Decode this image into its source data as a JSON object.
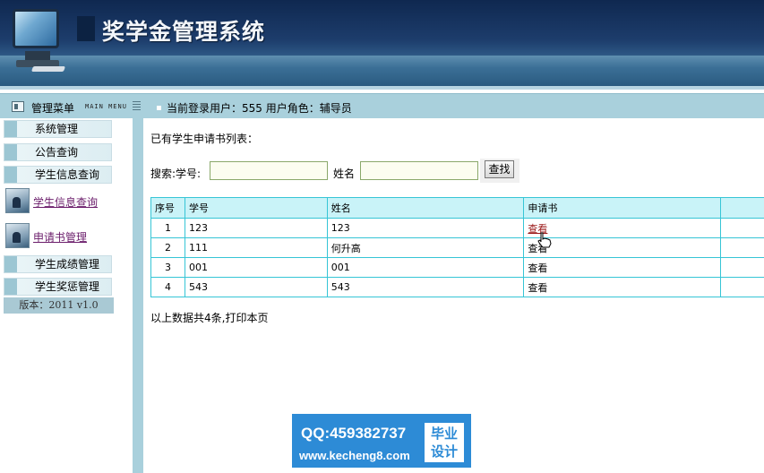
{
  "header": {
    "title": "奖学金管理系统"
  },
  "topbar": {
    "menu_label": "管理菜单",
    "menu_en": "MAIN MENU",
    "user_info": "当前登录用户：555   用户角色：辅导员"
  },
  "sidebar": {
    "items": [
      {
        "label": "系统管理"
      },
      {
        "label": "公告查询"
      },
      {
        "label": "学生信息查询"
      },
      {
        "label": "学生信息查询"
      },
      {
        "label": "申请书管理"
      },
      {
        "label": "学生成绩管理"
      },
      {
        "label": "学生奖惩管理"
      }
    ],
    "version": "版本：2011 v1.0"
  },
  "main": {
    "list_title": "已有学生申请书列表：",
    "search": {
      "label": "搜索:学号:",
      "name_label": "姓名",
      "button": "查找",
      "id_value": "",
      "name_value": ""
    },
    "table": {
      "headers": [
        "序号",
        "学号",
        "姓名",
        "申请书",
        ""
      ],
      "rows": [
        {
          "idx": "1",
          "id": "123",
          "name": "123",
          "action": "查看"
        },
        {
          "idx": "2",
          "id": "111",
          "name": "何升高",
          "action": "查看"
        },
        {
          "idx": "3",
          "id": "001",
          "name": "001",
          "action": "查看"
        },
        {
          "idx": "4",
          "id": "543",
          "name": "543",
          "action": "查看"
        }
      ]
    },
    "summary": "以上数据共4条,打印本页"
  },
  "watermark": {
    "qq": "QQ:459382737",
    "url": "www.kecheng8.com",
    "box_line1": "毕业",
    "box_line2": "设计"
  },
  "colors": {
    "accent": "#a9d0dc",
    "table_border": "#36c5d6",
    "header_bg": "#c9f3f8",
    "link_visited": "#6b1d6b",
    "watermark": "#2d8bd6"
  }
}
